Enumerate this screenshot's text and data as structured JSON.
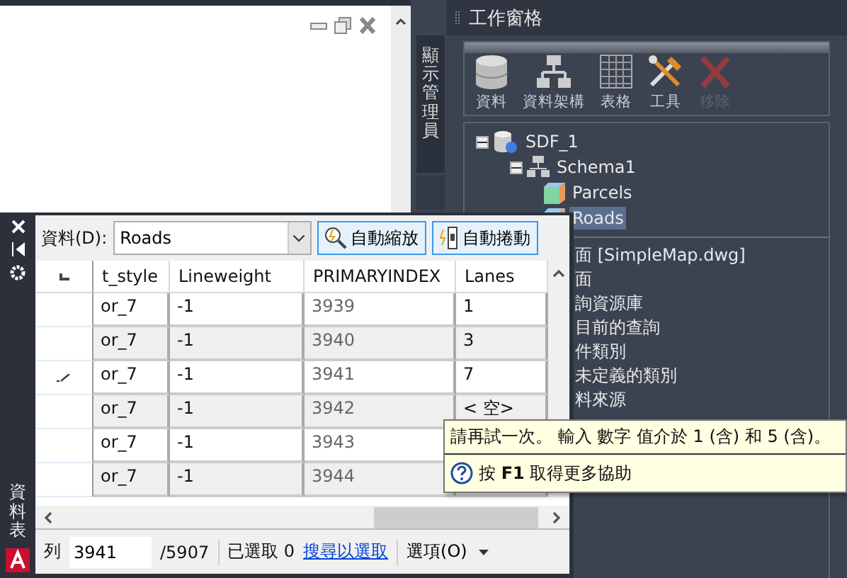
{
  "side_tab": {
    "label": "顯示管理員"
  },
  "task_pane": {
    "title": "工作窗格",
    "toolbar": [
      {
        "kind": "data",
        "label": "資料",
        "disabled": false
      },
      {
        "kind": "schema",
        "label": "資料架構",
        "disabled": false
      },
      {
        "kind": "table",
        "label": "表格",
        "disabled": false
      },
      {
        "kind": "tools",
        "label": "工具",
        "disabled": false
      },
      {
        "kind": "remove",
        "label": "移除",
        "disabled": true
      }
    ],
    "tree": [
      {
        "kind": "source",
        "label": "SDF_1",
        "expanded": true,
        "children": [
          {
            "kind": "schema",
            "label": "Schema1",
            "expanded": true,
            "children": [
              {
                "kind": "class",
                "label": "Parcels",
                "selected": false
              },
              {
                "kind": "class",
                "label": "Roads",
                "selected": true
              }
            ]
          }
        ]
      }
    ],
    "items": [
      "面 [SimpleMap.dwg]",
      "面",
      "詢資源庫",
      "目前的查詢",
      "件類別",
      "未定義的類別",
      "料來源"
    ]
  },
  "data_table": {
    "title": "資料表",
    "source_label": "資料(D):",
    "source_value": "Roads",
    "buttons": [
      {
        "kind": "zoom",
        "label": "自動縮放",
        "pressed": true
      },
      {
        "kind": "scroll",
        "label": "自動捲動",
        "pressed": true
      }
    ],
    "columns": [
      "t_style",
      "Lineweight",
      "PRIMARYINDEX",
      "Lanes"
    ],
    "rows": [
      {
        "cells": [
          "or_7",
          "-1",
          "3939",
          "1"
        ],
        "editing": false
      },
      {
        "cells": [
          "or_7",
          "-1",
          "3940",
          "3"
        ],
        "editing": false
      },
      {
        "cells": [
          "or_7",
          "-1",
          "3941",
          "7"
        ],
        "editing": true
      },
      {
        "cells": [
          "or_7",
          "-1",
          "3942",
          "< 空>"
        ],
        "editing": false
      },
      {
        "cells": [
          "or_7",
          "-1",
          "3943"
        ],
        "editing": false
      },
      {
        "cells": [
          "or_7",
          "-1",
          "3944"
        ],
        "editing": false
      }
    ],
    "status": {
      "row_label": "列",
      "row_value": "3941",
      "row_total": "/5907",
      "selected": "已選取 0",
      "link": "搜尋以選取",
      "options": "選項(O)"
    }
  },
  "tooltip": {
    "message": "請再試一次。 輸入 數字 值介於 1 (含) 和 5 (含)。",
    "help": "按 **F1** 取得更多協助"
  }
}
